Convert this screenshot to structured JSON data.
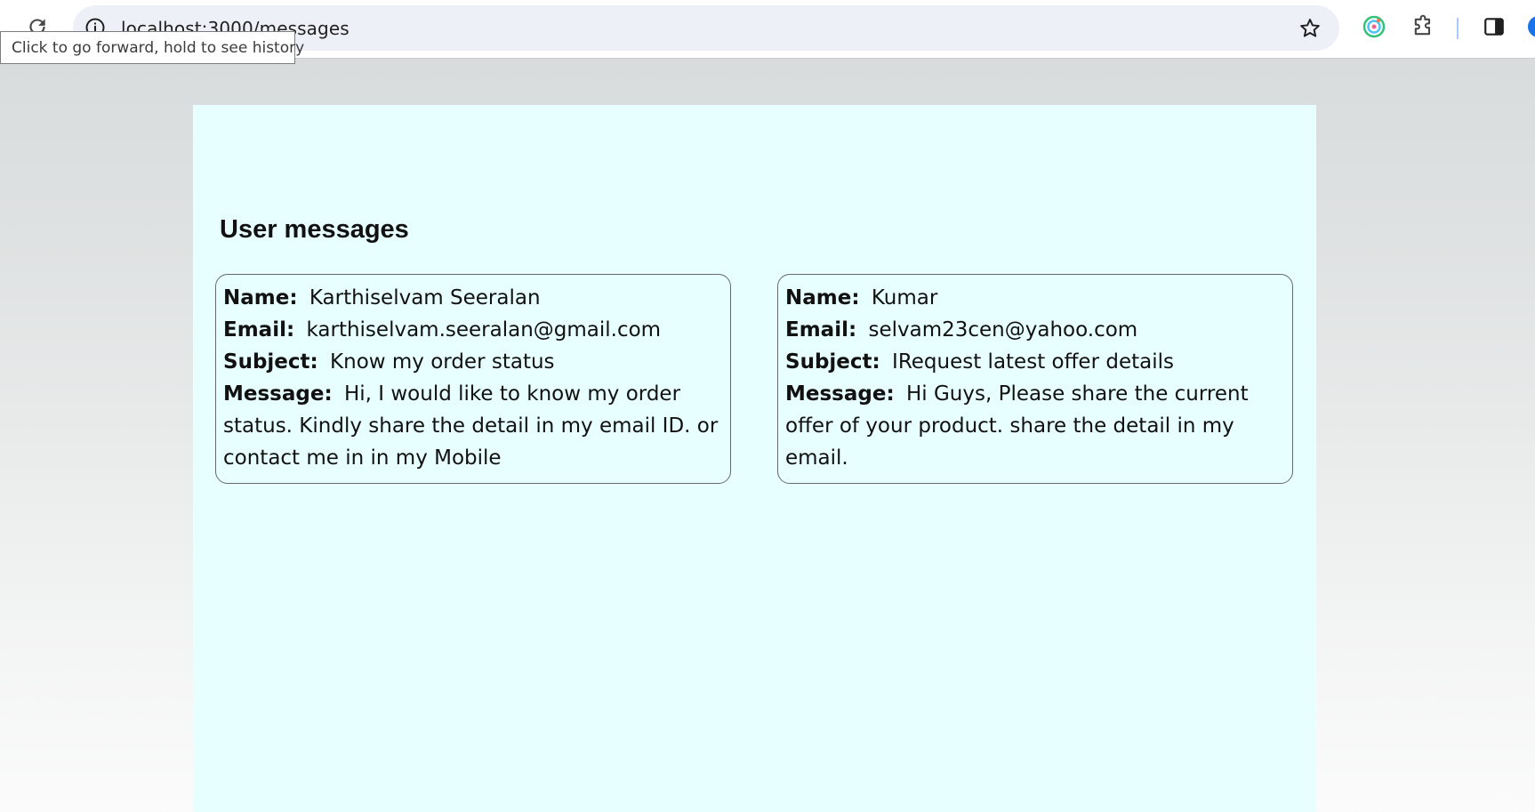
{
  "browser": {
    "url": "localhost:3000/messages",
    "tooltip": "Click to go forward, hold to see history",
    "icons": {
      "reload": "reload-icon",
      "site_info": "info-icon",
      "bookmark": "star-icon",
      "extension_1": "target-extension-icon",
      "extensions": "puzzle-icon",
      "side_panel": "side-panel-icon"
    }
  },
  "page": {
    "background_color": "#e8ffff",
    "title": "User messages",
    "field_labels": {
      "name": "Name:",
      "email": "Email:",
      "subject": "Subject:",
      "message": "Message:"
    },
    "messages": [
      {
        "name": "Karthiselvam Seeralan",
        "email": "karthiselvam.seeralan@gmail.com",
        "subject": "Know my order status",
        "message": "Hi, I would like to know my order status. Kindly share the detail in my email ID. or contact me in in my Mobile"
      },
      {
        "name": "Kumar",
        "email": "selvam23cen@yahoo.com",
        "subject": "IRequest latest offer details",
        "message": "Hi Guys, Please share the current offer of your product. share the detail in my email."
      }
    ]
  }
}
